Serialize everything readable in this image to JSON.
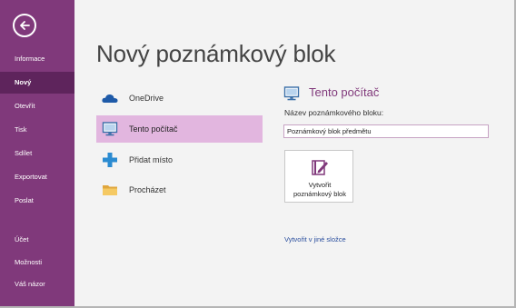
{
  "sidebar": {
    "back_icon": "back-arrow-icon",
    "items": [
      {
        "label": "Informace",
        "active": false
      },
      {
        "label": "Nový",
        "active": true
      },
      {
        "label": "Otevřít",
        "active": false
      },
      {
        "label": "Tisk",
        "active": false
      },
      {
        "label": "Sdílet",
        "active": false
      },
      {
        "label": "Exportovat",
        "active": false
      },
      {
        "label": "Poslat",
        "active": false
      },
      {
        "label": "Účet",
        "active": false
      },
      {
        "label": "Možnosti",
        "active": false
      },
      {
        "label": "Váš názor",
        "active": false
      }
    ]
  },
  "main": {
    "title": "Nový poznámkový blok",
    "locations": [
      {
        "label": "OneDrive",
        "icon": "cloud-icon",
        "active": false
      },
      {
        "label": "Tento počítač",
        "icon": "computer-icon",
        "active": true
      },
      {
        "label": "Přidat místo",
        "icon": "plus-icon",
        "active": false
      },
      {
        "label": "Procházet",
        "icon": "folder-icon",
        "active": false
      }
    ]
  },
  "panel": {
    "title": "Tento počítač",
    "icon": "computer-icon",
    "field_label": "Název poznámkového bloku:",
    "name_value": "Poznámkový blok předmětu",
    "create_button_line1": "Vytvořit",
    "create_button_line2": "poznámkový blok",
    "create_icon": "notebook-icon",
    "other_folder_link": "Vytvořit v jiné složce"
  },
  "colors": {
    "sidebar": "#80397b",
    "sidebar_active": "#5e245c",
    "selected_location": "#e2b6df",
    "accent_text": "#80397b",
    "link": "#2b4f9e"
  }
}
